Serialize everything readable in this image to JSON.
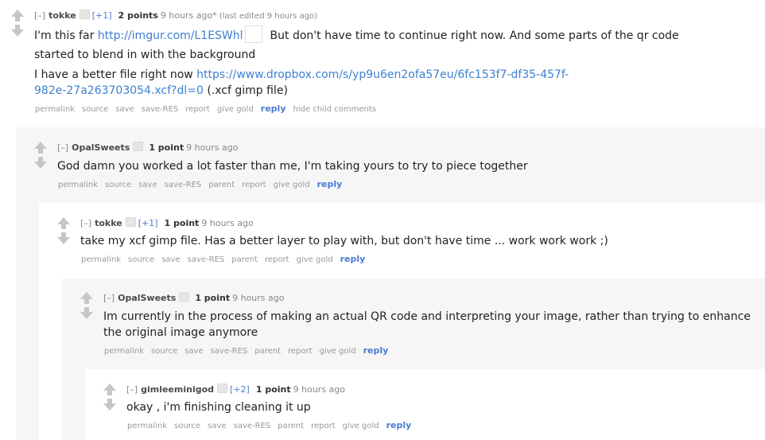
{
  "common": {
    "collapse": "[–]",
    "buttons": {
      "permalink": "permalink",
      "source": "source",
      "save": "save",
      "save_res": "save-RES",
      "parent": "parent",
      "report": "report",
      "give_gold": "give gold",
      "reply": "reply",
      "hide_child": "hide child comments"
    }
  },
  "comments": [
    {
      "author": "tokke",
      "karma": "[+1]",
      "score": "2 points",
      "time": "9 hours ago*",
      "edited": "(last edited 9 hours ago)",
      "line1_pre": "I'm this far ",
      "line1_link": "http://imgur.com/L1ESWhl",
      "line1_post": "But don't have time to continue right now. And some parts of the qr code",
      "line2": "started to blend in with the background",
      "line3_pre": "I have a better file right now ",
      "line3_link_a": "https://www.dropbox.com/s/yp9u6en2ofa57eu/6fc153f7-df35-457f-",
      "line4_link_b": "982e-27a263703054.xcf?dl=0",
      "line4_post": " (.xcf gimp file)"
    },
    {
      "author": "OpalSweets",
      "score": "1 point",
      "time": "9 hours ago",
      "text": "God damn you worked a lot faster than me, I'm taking yours to try to piece together"
    },
    {
      "author": "tokke",
      "karma": "[+1]",
      "score": "1 point",
      "time": "9 hours ago",
      "text": "take my xcf gimp file. Has a better layer to play with, but don't have time ... work work work ;)"
    },
    {
      "author": "OpalSweets",
      "score": "1 point",
      "time": "9 hours ago",
      "line1": "Im currently in the process of making an actual QR code and interpreting your image, rather than trying to enhance",
      "line2": "the original image anymore"
    },
    {
      "author": "gimleeminigod",
      "karma": "[+2]",
      "score": "1 point",
      "time": "9 hours ago",
      "text": "okay , i'm finishing cleaning it up"
    }
  ]
}
